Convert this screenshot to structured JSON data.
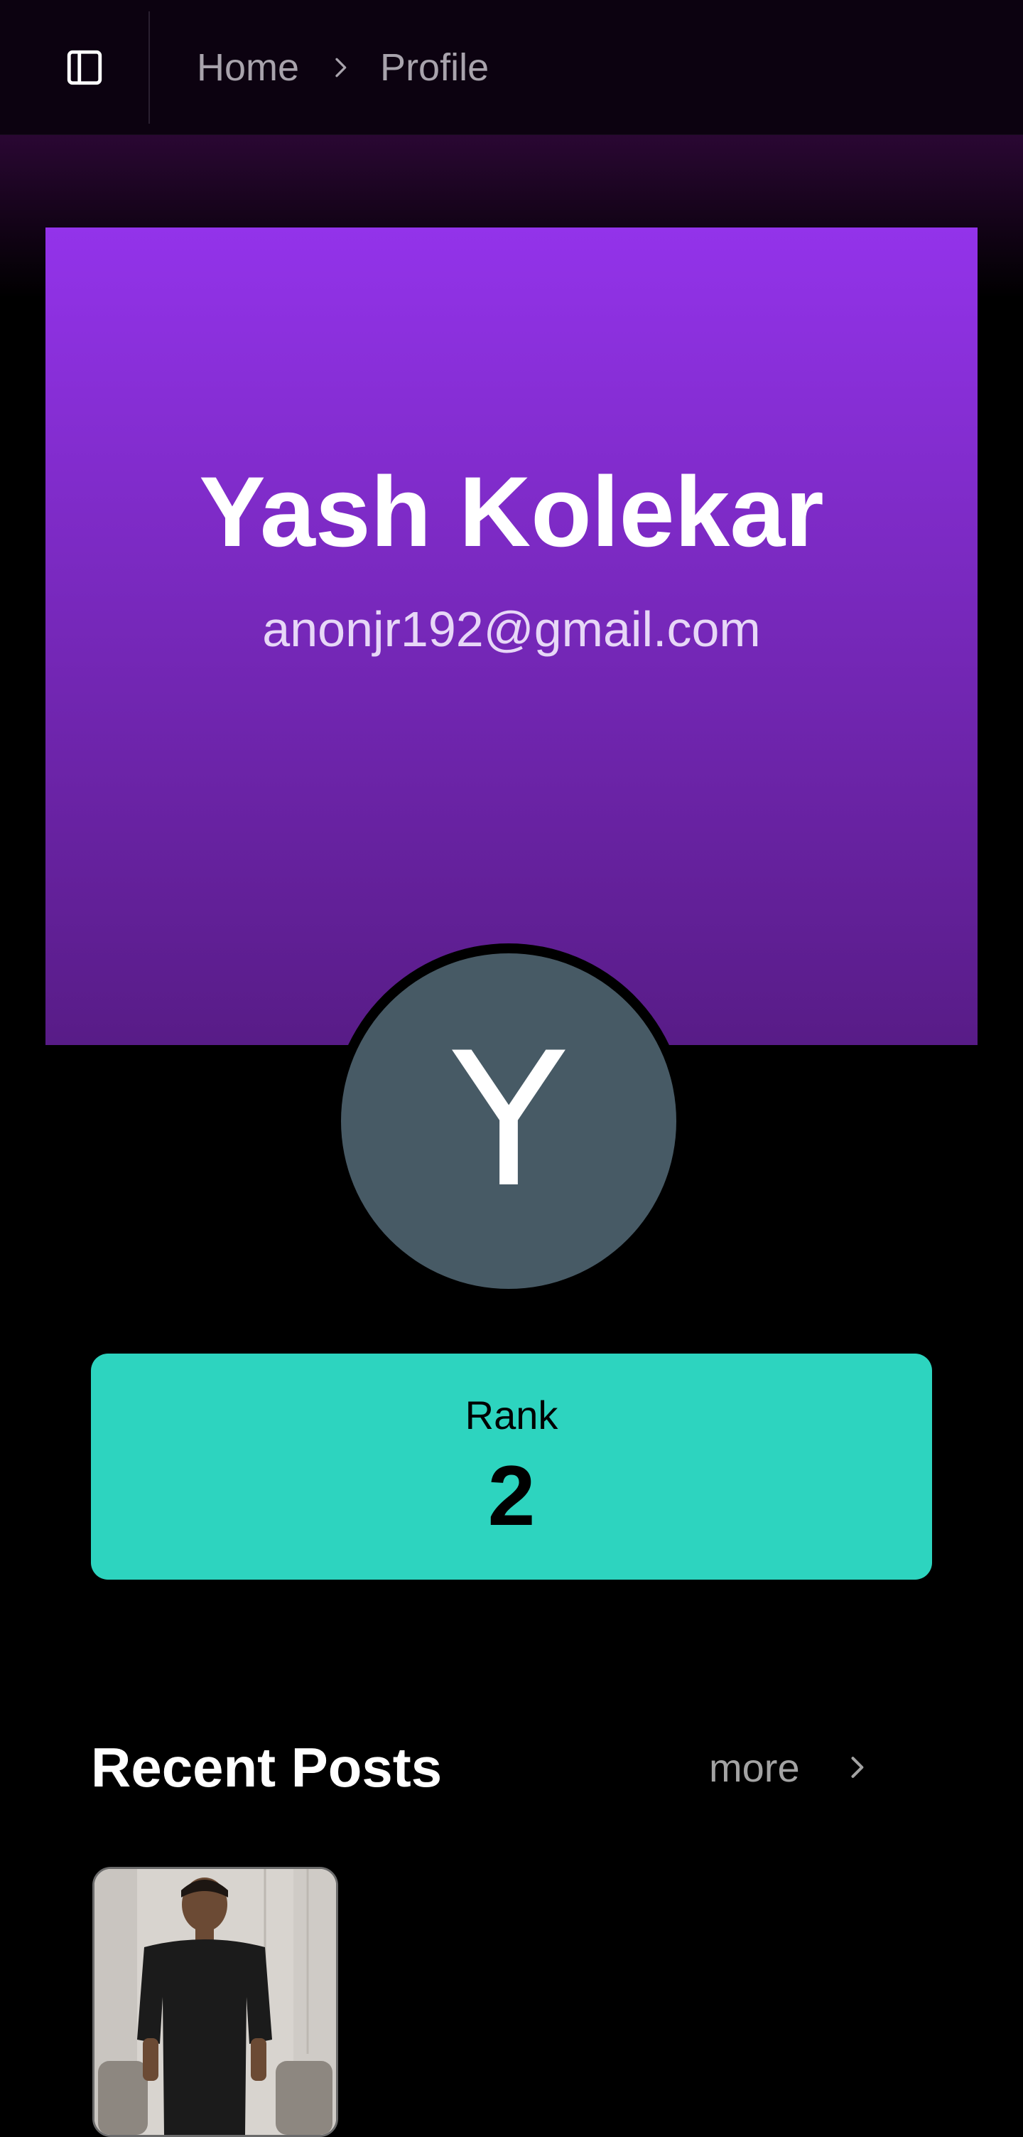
{
  "header": {
    "breadcrumb": [
      "Home",
      "Profile"
    ],
    "sidebar_toggle_icon": "panel-left-icon"
  },
  "profile": {
    "name": "Yash Kolekar",
    "email": "anonjr192@gmail.com",
    "avatar_initial": "Y",
    "banner_colors": [
      "#9333ea",
      "#581c87"
    ],
    "avatar_color": "#475a65"
  },
  "rank": {
    "label": "Rank",
    "value": "2",
    "color": "#2dd4bf"
  },
  "recent_posts": {
    "title": "Recent Posts",
    "more_label": "more",
    "posts": [
      {
        "thumbnail": "person-photo"
      }
    ]
  }
}
